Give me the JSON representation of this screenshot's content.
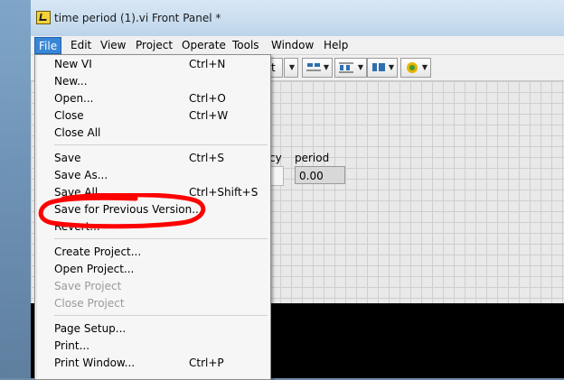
{
  "window": {
    "title": "time period (1).vi Front Panel *"
  },
  "menubar": {
    "items": [
      "File",
      "Edit",
      "View",
      "Project",
      "Operate",
      "Tools",
      "Window",
      "Help"
    ]
  },
  "toolbar": {
    "visible_text": "t"
  },
  "panel": {
    "label_left": "cy",
    "label_period": "period",
    "period_value": "0.00"
  },
  "file_menu": {
    "items": [
      {
        "label": "New VI",
        "shortcut": "Ctrl+N"
      },
      {
        "label": "New...",
        "shortcut": ""
      },
      {
        "label": "Open...",
        "shortcut": "Ctrl+O"
      },
      {
        "label": "Close",
        "shortcut": "Ctrl+W"
      },
      {
        "label": "Close All",
        "shortcut": ""
      },
      {
        "label": "Save",
        "shortcut": "Ctrl+S"
      },
      {
        "label": "Save As...",
        "shortcut": ""
      },
      {
        "label": "Save All",
        "shortcut": "Ctrl+Shift+S"
      },
      {
        "label": "Save for Previous Version...",
        "shortcut": ""
      },
      {
        "label": "Revert...",
        "shortcut": ""
      },
      {
        "label": "Create Project...",
        "shortcut": ""
      },
      {
        "label": "Open Project...",
        "shortcut": ""
      },
      {
        "label": "Save Project",
        "shortcut": ""
      },
      {
        "label": "Close Project",
        "shortcut": ""
      },
      {
        "label": "Page Setup...",
        "shortcut": ""
      },
      {
        "label": "Print...",
        "shortcut": ""
      },
      {
        "label": "Print Window...",
        "shortcut": "Ctrl+P"
      }
    ]
  },
  "annotation": {
    "color": "#ff0000"
  }
}
